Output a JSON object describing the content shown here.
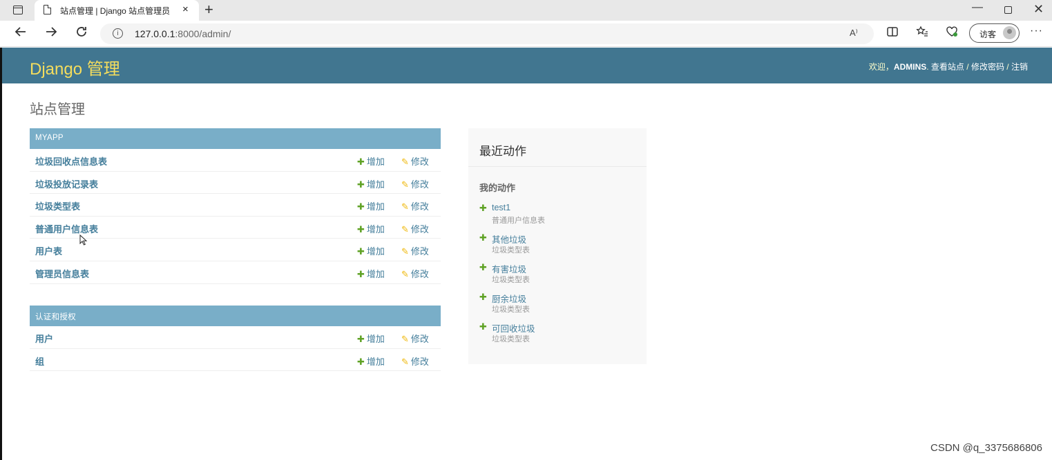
{
  "browser": {
    "tab_title": "站点管理 | Django 站点管理员",
    "tab_close": "×",
    "new_tab": "+",
    "url_host": "127.0.0.1",
    "url_rest": ":8000/admin/",
    "read_aloud": "A⁾",
    "guest_label": "访客",
    "more": "···",
    "win_min": "—",
    "win_close": "✕",
    "icons": [
      "tab-actions-icon",
      "page-icon",
      "back-arrow-icon",
      "forward-arrow-icon",
      "refresh-icon",
      "info-icon",
      "read-aloud-icon",
      "split-screen-icon",
      "favorites-icon",
      "browser-essentials-icon",
      "guest-avatar-icon",
      "more-icon"
    ]
  },
  "header": {
    "branding": "Django 管理",
    "welcome": "欢迎，",
    "username": "ADMINS",
    "view_site": "查看站点",
    "change_password": "修改密码",
    "logout": "注销",
    "sep": " / ",
    "colors": {
      "bar": "#417690",
      "brand": "#f5dd5d"
    }
  },
  "page_title": "站点管理",
  "modules": [
    {
      "caption": "MYAPP",
      "models": [
        {
          "name": "垃圾回收点信息表",
          "add": "增加",
          "change": "修改"
        },
        {
          "name": "垃圾投放记录表",
          "add": "增加",
          "change": "修改"
        },
        {
          "name": "垃圾类型表",
          "add": "增加",
          "change": "修改"
        },
        {
          "name": "普通用户信息表",
          "add": "增加",
          "change": "修改"
        },
        {
          "name": "用户表",
          "add": "增加",
          "change": "修改"
        },
        {
          "name": "管理员信息表",
          "add": "增加",
          "change": "修改"
        }
      ]
    },
    {
      "caption": "认证和授权",
      "models": [
        {
          "name": "用户",
          "add": "增加",
          "change": "修改"
        },
        {
          "name": "组",
          "add": "增加",
          "change": "修改"
        }
      ]
    }
  ],
  "recent": {
    "title": "最近动作",
    "subtitle": "我的动作",
    "actions": [
      {
        "name": "test1",
        "type": "普通用户信息表"
      },
      {
        "name": "其他垃圾",
        "type": "垃圾类型表"
      },
      {
        "name": "有害垃圾",
        "type": "垃圾类型表"
      },
      {
        "name": "厨余垃圾",
        "type": "垃圾类型表"
      },
      {
        "name": "可回收垃圾",
        "type": "垃圾类型表"
      }
    ]
  },
  "watermark": "CSDN @q_3375686806"
}
